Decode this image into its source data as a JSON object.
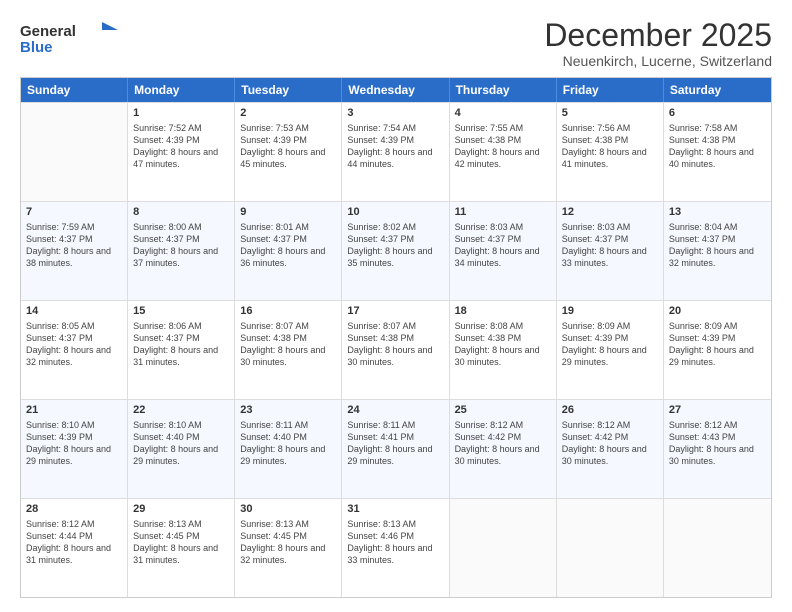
{
  "logo": {
    "line1": "General",
    "line2": "Blue"
  },
  "title": "December 2025",
  "location": "Neuenkirch, Lucerne, Switzerland",
  "weekdays": [
    "Sunday",
    "Monday",
    "Tuesday",
    "Wednesday",
    "Thursday",
    "Friday",
    "Saturday"
  ],
  "weeks": [
    [
      {
        "day": "",
        "sunrise": "",
        "sunset": "",
        "daylight": ""
      },
      {
        "day": "1",
        "sunrise": "Sunrise: 7:52 AM",
        "sunset": "Sunset: 4:39 PM",
        "daylight": "Daylight: 8 hours and 47 minutes."
      },
      {
        "day": "2",
        "sunrise": "Sunrise: 7:53 AM",
        "sunset": "Sunset: 4:39 PM",
        "daylight": "Daylight: 8 hours and 45 minutes."
      },
      {
        "day": "3",
        "sunrise": "Sunrise: 7:54 AM",
        "sunset": "Sunset: 4:39 PM",
        "daylight": "Daylight: 8 hours and 44 minutes."
      },
      {
        "day": "4",
        "sunrise": "Sunrise: 7:55 AM",
        "sunset": "Sunset: 4:38 PM",
        "daylight": "Daylight: 8 hours and 42 minutes."
      },
      {
        "day": "5",
        "sunrise": "Sunrise: 7:56 AM",
        "sunset": "Sunset: 4:38 PM",
        "daylight": "Daylight: 8 hours and 41 minutes."
      },
      {
        "day": "6",
        "sunrise": "Sunrise: 7:58 AM",
        "sunset": "Sunset: 4:38 PM",
        "daylight": "Daylight: 8 hours and 40 minutes."
      }
    ],
    [
      {
        "day": "7",
        "sunrise": "Sunrise: 7:59 AM",
        "sunset": "Sunset: 4:37 PM",
        "daylight": "Daylight: 8 hours and 38 minutes."
      },
      {
        "day": "8",
        "sunrise": "Sunrise: 8:00 AM",
        "sunset": "Sunset: 4:37 PM",
        "daylight": "Daylight: 8 hours and 37 minutes."
      },
      {
        "day": "9",
        "sunrise": "Sunrise: 8:01 AM",
        "sunset": "Sunset: 4:37 PM",
        "daylight": "Daylight: 8 hours and 36 minutes."
      },
      {
        "day": "10",
        "sunrise": "Sunrise: 8:02 AM",
        "sunset": "Sunset: 4:37 PM",
        "daylight": "Daylight: 8 hours and 35 minutes."
      },
      {
        "day": "11",
        "sunrise": "Sunrise: 8:03 AM",
        "sunset": "Sunset: 4:37 PM",
        "daylight": "Daylight: 8 hours and 34 minutes."
      },
      {
        "day": "12",
        "sunrise": "Sunrise: 8:03 AM",
        "sunset": "Sunset: 4:37 PM",
        "daylight": "Daylight: 8 hours and 33 minutes."
      },
      {
        "day": "13",
        "sunrise": "Sunrise: 8:04 AM",
        "sunset": "Sunset: 4:37 PM",
        "daylight": "Daylight: 8 hours and 32 minutes."
      }
    ],
    [
      {
        "day": "14",
        "sunrise": "Sunrise: 8:05 AM",
        "sunset": "Sunset: 4:37 PM",
        "daylight": "Daylight: 8 hours and 32 minutes."
      },
      {
        "day": "15",
        "sunrise": "Sunrise: 8:06 AM",
        "sunset": "Sunset: 4:37 PM",
        "daylight": "Daylight: 8 hours and 31 minutes."
      },
      {
        "day": "16",
        "sunrise": "Sunrise: 8:07 AM",
        "sunset": "Sunset: 4:38 PM",
        "daylight": "Daylight: 8 hours and 30 minutes."
      },
      {
        "day": "17",
        "sunrise": "Sunrise: 8:07 AM",
        "sunset": "Sunset: 4:38 PM",
        "daylight": "Daylight: 8 hours and 30 minutes."
      },
      {
        "day": "18",
        "sunrise": "Sunrise: 8:08 AM",
        "sunset": "Sunset: 4:38 PM",
        "daylight": "Daylight: 8 hours and 30 minutes."
      },
      {
        "day": "19",
        "sunrise": "Sunrise: 8:09 AM",
        "sunset": "Sunset: 4:39 PM",
        "daylight": "Daylight: 8 hours and 29 minutes."
      },
      {
        "day": "20",
        "sunrise": "Sunrise: 8:09 AM",
        "sunset": "Sunset: 4:39 PM",
        "daylight": "Daylight: 8 hours and 29 minutes."
      }
    ],
    [
      {
        "day": "21",
        "sunrise": "Sunrise: 8:10 AM",
        "sunset": "Sunset: 4:39 PM",
        "daylight": "Daylight: 8 hours and 29 minutes."
      },
      {
        "day": "22",
        "sunrise": "Sunrise: 8:10 AM",
        "sunset": "Sunset: 4:40 PM",
        "daylight": "Daylight: 8 hours and 29 minutes."
      },
      {
        "day": "23",
        "sunrise": "Sunrise: 8:11 AM",
        "sunset": "Sunset: 4:40 PM",
        "daylight": "Daylight: 8 hours and 29 minutes."
      },
      {
        "day": "24",
        "sunrise": "Sunrise: 8:11 AM",
        "sunset": "Sunset: 4:41 PM",
        "daylight": "Daylight: 8 hours and 29 minutes."
      },
      {
        "day": "25",
        "sunrise": "Sunrise: 8:12 AM",
        "sunset": "Sunset: 4:42 PM",
        "daylight": "Daylight: 8 hours and 30 minutes."
      },
      {
        "day": "26",
        "sunrise": "Sunrise: 8:12 AM",
        "sunset": "Sunset: 4:42 PM",
        "daylight": "Daylight: 8 hours and 30 minutes."
      },
      {
        "day": "27",
        "sunrise": "Sunrise: 8:12 AM",
        "sunset": "Sunset: 4:43 PM",
        "daylight": "Daylight: 8 hours and 30 minutes."
      }
    ],
    [
      {
        "day": "28",
        "sunrise": "Sunrise: 8:12 AM",
        "sunset": "Sunset: 4:44 PM",
        "daylight": "Daylight: 8 hours and 31 minutes."
      },
      {
        "day": "29",
        "sunrise": "Sunrise: 8:13 AM",
        "sunset": "Sunset: 4:45 PM",
        "daylight": "Daylight: 8 hours and 31 minutes."
      },
      {
        "day": "30",
        "sunrise": "Sunrise: 8:13 AM",
        "sunset": "Sunset: 4:45 PM",
        "daylight": "Daylight: 8 hours and 32 minutes."
      },
      {
        "day": "31",
        "sunrise": "Sunrise: 8:13 AM",
        "sunset": "Sunset: 4:46 PM",
        "daylight": "Daylight: 8 hours and 33 minutes."
      },
      {
        "day": "",
        "sunrise": "",
        "sunset": "",
        "daylight": ""
      },
      {
        "day": "",
        "sunrise": "",
        "sunset": "",
        "daylight": ""
      },
      {
        "day": "",
        "sunrise": "",
        "sunset": "",
        "daylight": ""
      }
    ]
  ]
}
